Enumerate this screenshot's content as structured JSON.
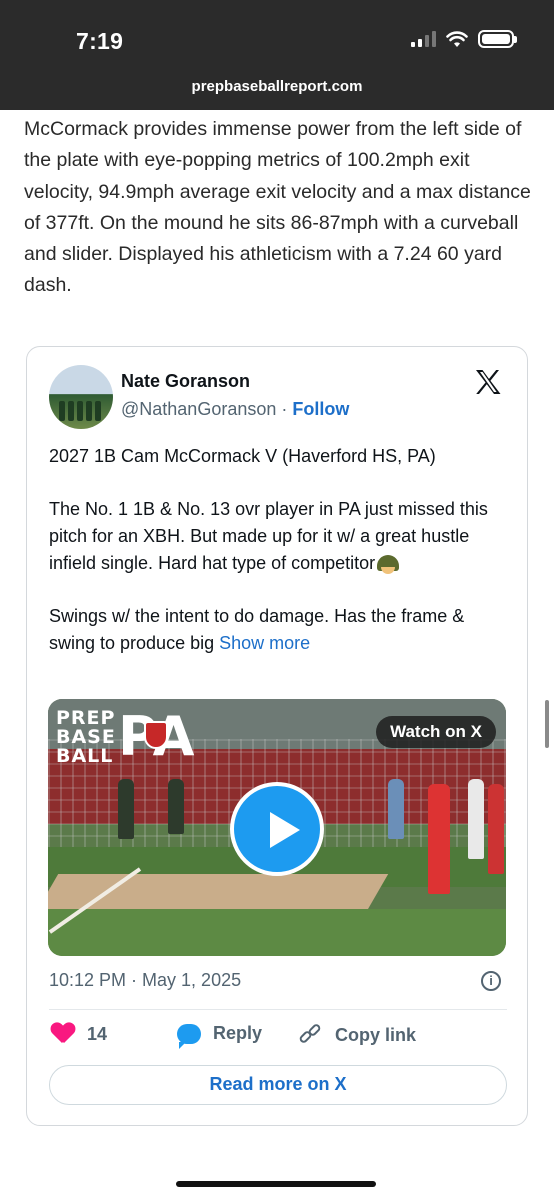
{
  "status_bar": {
    "time": "7:19",
    "url": "prepbaseballreport.com"
  },
  "article": {
    "paragraph": "McCormack provides immense power from the left side of the plate with eye-popping metrics of 100.2mph exit velocity, 94.9mph average exit velocity and a max distance of 377ft. On the mound he sits 86-87mph with a curveball and slider. Displayed his athleticism with a 7.24 60 yard dash."
  },
  "tweet": {
    "author_name": "Nate Goranson",
    "handle": "@NathanGoranson",
    "separator": " · ",
    "follow_label": "Follow",
    "text_line1": "2027 1B Cam McCormack V (Haverford HS, PA)",
    "text_para2": "The No. 1 1B & No. 13 ovr player in PA just missed this pitch for an XBH. But made up for it w/ a great hustle infield single. Hard hat type of competitor",
    "text_para3": "Swings w/ the intent to do damage. Has the frame & swing to produce big ",
    "show_more": "Show more",
    "video": {
      "brand_text": [
        "PREP",
        "BASE",
        "BALL"
      ],
      "brand_pa": "PA",
      "watch_label": "Watch on X"
    },
    "timestamp": "10:12 PM · May 1, 2025",
    "likes": "14",
    "reply_label": "Reply",
    "copy_link_label": "Copy link",
    "read_more_label": "Read more on X"
  },
  "colors": {
    "link_blue": "#1d6fc9",
    "like_pink": "#f91880",
    "play_blue": "#1d9bf0"
  },
  "icons": [
    "signal-icon",
    "wifi-icon",
    "battery-icon",
    "x-logo-icon",
    "play-icon",
    "info-icon",
    "heart-icon",
    "reply-bubble-icon",
    "link-icon"
  ]
}
